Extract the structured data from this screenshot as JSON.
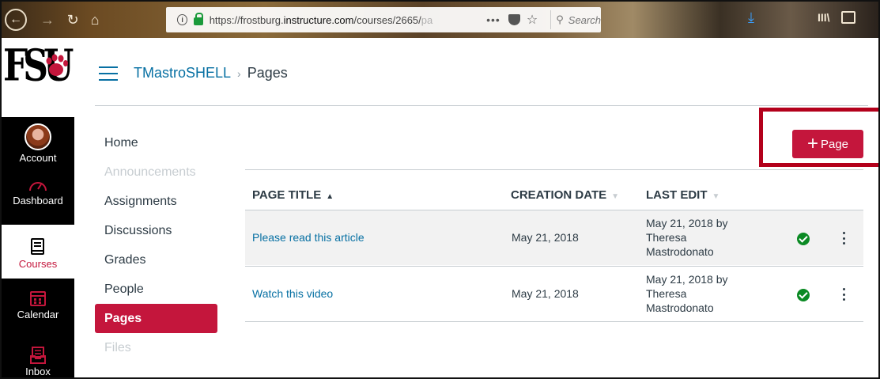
{
  "browser": {
    "url_prefix": "https://frostburg.",
    "url_domain": "instructure.com",
    "url_path": "/courses/2665/",
    "url_fade": "pa",
    "more": "•••",
    "search_placeholder": "Search",
    "library": "III\\"
  },
  "global_nav": {
    "logo_text": "FSU",
    "items": [
      {
        "label": "Account",
        "icon": "avatar"
      },
      {
        "label": "Dashboard",
        "icon": "dashboard-icon"
      },
      {
        "label": "Courses",
        "icon": "courses-icon"
      },
      {
        "label": "Calendar",
        "icon": "calendar-icon"
      },
      {
        "label": "Inbox",
        "icon": "inbox-icon"
      }
    ],
    "active": "Courses",
    "active_color": "#c4163c"
  },
  "breadcrumb": {
    "course": "TMastroSHELL",
    "separator": "›",
    "page": "Pages"
  },
  "course_nav": {
    "items": [
      "Home",
      "Announcements",
      "Assignments",
      "Discussions",
      "Grades",
      "People",
      "Pages",
      "Files"
    ],
    "muted": [
      "Announcements",
      "Files"
    ],
    "active": "Pages"
  },
  "add_button": {
    "plus": "+",
    "label": "Page",
    "color": "#c4163c"
  },
  "table": {
    "headers": {
      "title": "PAGE TITLE",
      "title_sort": "▲",
      "creation": "CREATION DATE",
      "creation_sort": "▼",
      "last_edit": "LAST EDIT",
      "last_edit_sort": "▼"
    },
    "rows": [
      {
        "title": "Please read this article",
        "creation_date": "May 21, 2018",
        "last_edit_line1": "May 21, 2018 by",
        "last_edit_line2": "Theresa",
        "last_edit_line3": "Mastrodonato",
        "published": true
      },
      {
        "title": "Watch this video",
        "creation_date": "May 21, 2018",
        "last_edit_line1": "May 21, 2018 by",
        "last_edit_line2": "Theresa",
        "last_edit_line3": "Mastrodonato",
        "published": true
      }
    ]
  },
  "colors": {
    "link": "#0770a3",
    "published": "#0b8a24",
    "highlight": "#b3001b"
  }
}
